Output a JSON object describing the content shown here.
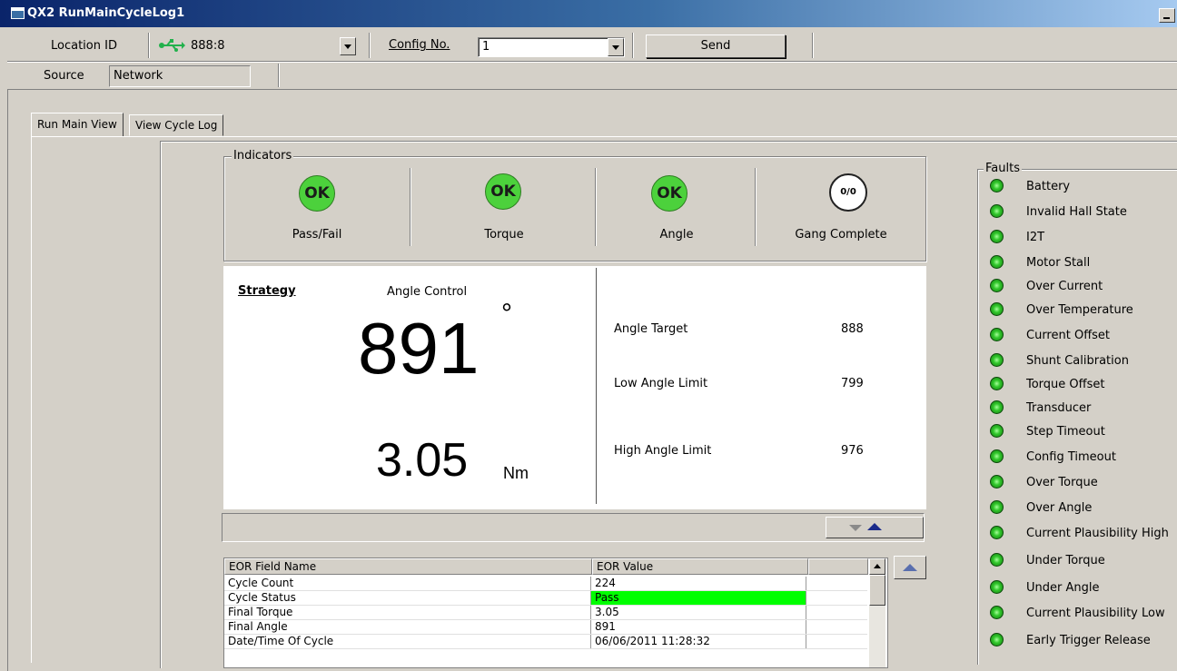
{
  "window": {
    "title": "QX2 RunMainCycleLog1"
  },
  "toolbar": {
    "location_label": "Location ID",
    "location_value": "888:8",
    "config_label": "Config No.",
    "config_value": "1",
    "send_label": "Send",
    "source_label": "Source",
    "source_value": "Network"
  },
  "tabs": [
    "Run Main View",
    "View Cycle Log"
  ],
  "indicators": {
    "title": "Indicators",
    "items": [
      {
        "badge": "OK",
        "label": "Pass/Fail"
      },
      {
        "badge": "OK",
        "label": "Torque"
      },
      {
        "badge": "OK",
        "label": "Angle"
      },
      {
        "badge": "0/0",
        "label": "Gang Complete"
      }
    ]
  },
  "strategy": {
    "label": "Strategy",
    "value": "Angle Control",
    "angle": "891",
    "degree": "°",
    "torque": "3.05",
    "torque_unit": "Nm"
  },
  "limits": [
    {
      "label": "Angle Target",
      "value": "888"
    },
    {
      "label": "Low Angle Limit",
      "value": "799"
    },
    {
      "label": "High Angle Limit",
      "value": "976"
    }
  ],
  "eor": {
    "col1": "EOR Field Name",
    "col2": "EOR Value",
    "rows": [
      {
        "name": "Cycle Count",
        "value": "224"
      },
      {
        "name": "Cycle Status",
        "value": "Pass"
      },
      {
        "name": "Final Torque",
        "value": "3.05"
      },
      {
        "name": "Final Angle",
        "value": "891"
      },
      {
        "name": "Date/Time Of Cycle",
        "value": "06/06/2011 11:28:32"
      }
    ]
  },
  "faults": {
    "title": "Faults",
    "items": [
      "Battery",
      "Invalid Hall State",
      "I2T",
      "Motor Stall",
      "Over Current",
      "Over Temperature",
      "Current Offset",
      "Shunt Calibration",
      "Torque Offset",
      "Transducer",
      "Step Timeout",
      "Config Timeout",
      "Over Torque",
      "Over Angle",
      "Current Plausibility High",
      "Under Torque",
      "Under Angle",
      "Current Plausibility Low",
      "Early Trigger Release"
    ]
  },
  "colors": {
    "ok_green": "#4cd13c",
    "pass_green": "#00ff00",
    "title_blue": "#0a246a"
  }
}
